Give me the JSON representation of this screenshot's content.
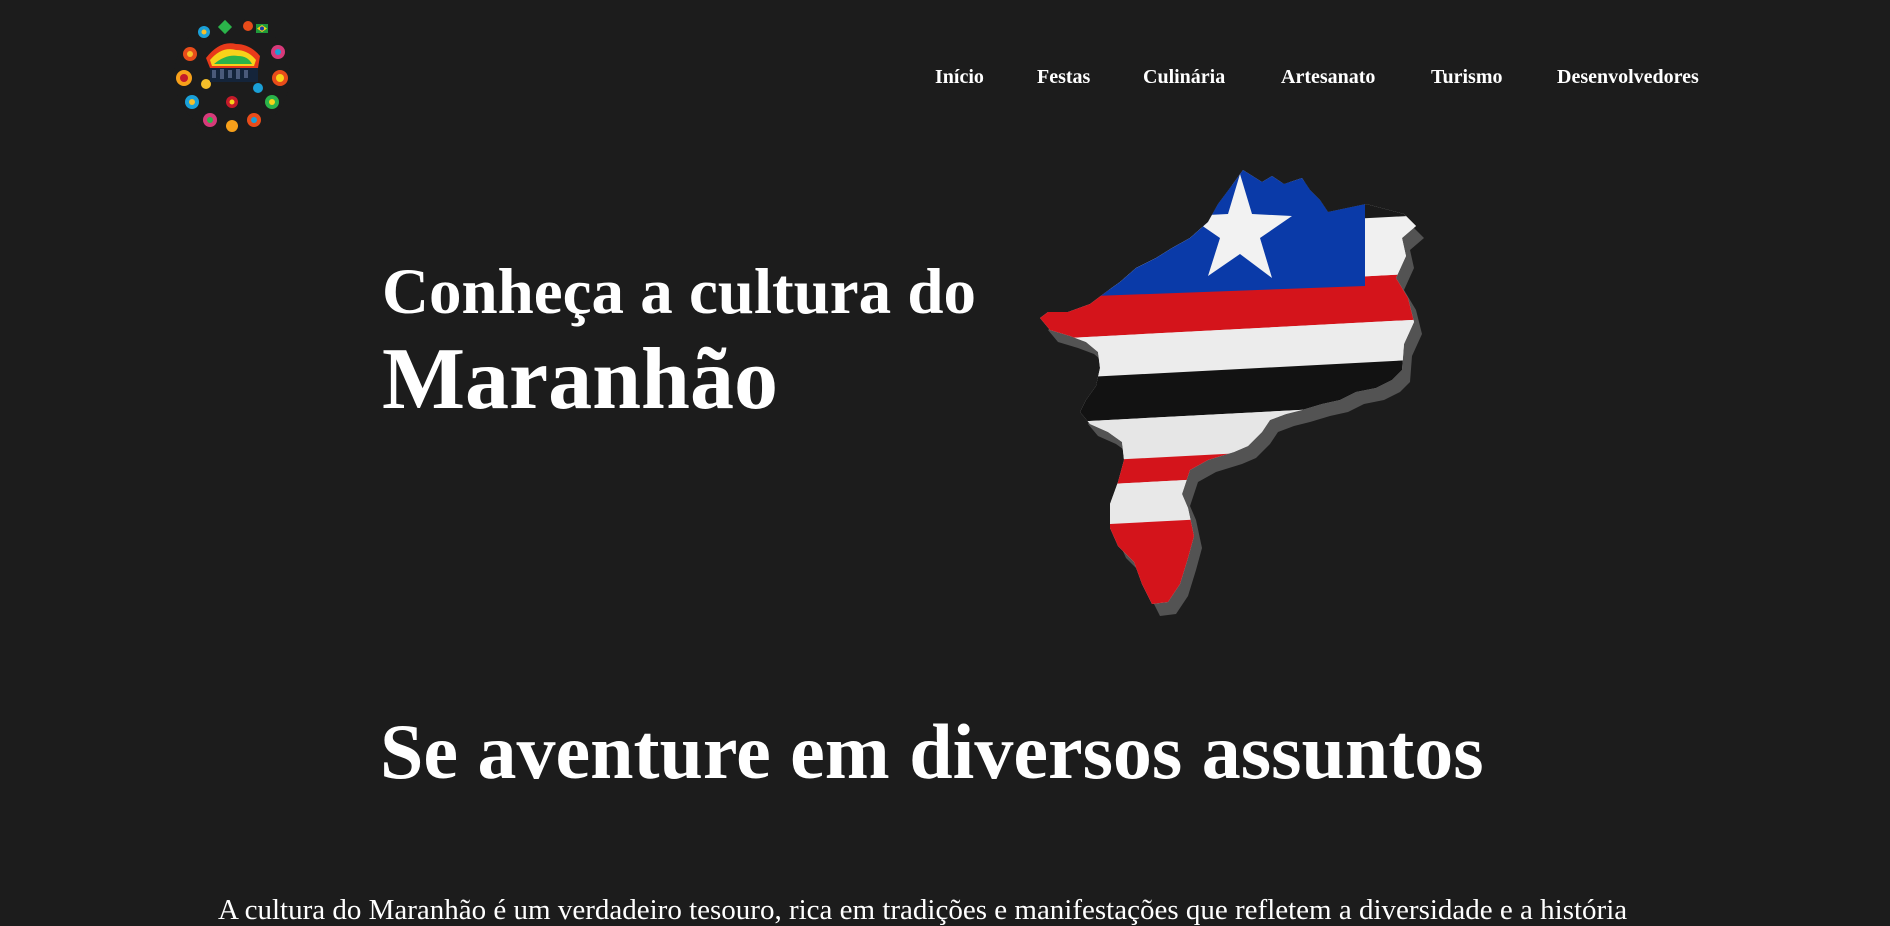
{
  "header": {
    "logo_icon": "maranhao-cultural-mosaic-logo",
    "nav": [
      {
        "label": "Início"
      },
      {
        "label": "Festas"
      },
      {
        "label": "Culinária"
      },
      {
        "label": "Artesanato"
      },
      {
        "label": "Turismo"
      },
      {
        "label": "Desenvolvedores"
      }
    ]
  },
  "hero": {
    "line1": "Conheça a cultura do",
    "line2": "Maranhão",
    "image_icon": "maranhao-flag-map-3d"
  },
  "section": {
    "title": "Se aventure em diversos assuntos",
    "intro": "A cultura do Maranhão é um verdadeiro tesouro, rica em tradições e manifestações que refletem a diversidade e a história"
  },
  "colors": {
    "background": "#1c1c1c",
    "text": "#ffffff",
    "flag_blue": "#0a3aa8",
    "flag_red": "#d4141b",
    "flag_white": "#e8e8e8",
    "flag_black": "#121212"
  }
}
